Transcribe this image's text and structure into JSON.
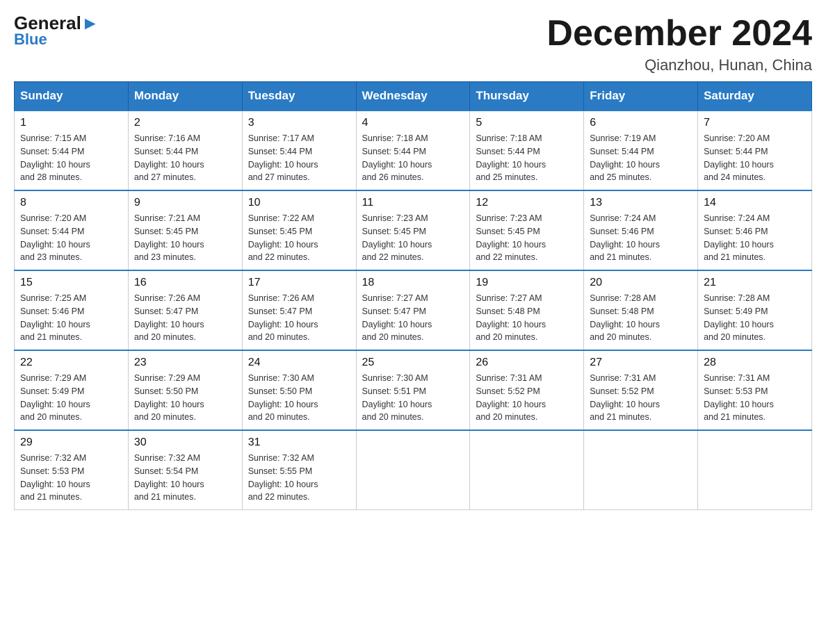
{
  "header": {
    "logo_general": "General",
    "logo_blue": "Blue",
    "title": "December 2024",
    "subtitle": "Qianzhou, Hunan, China"
  },
  "columns": [
    "Sunday",
    "Monday",
    "Tuesday",
    "Wednesday",
    "Thursday",
    "Friday",
    "Saturday"
  ],
  "weeks": [
    [
      {
        "day": "1",
        "sunrise": "7:15 AM",
        "sunset": "5:44 PM",
        "daylight": "10 hours and 28 minutes."
      },
      {
        "day": "2",
        "sunrise": "7:16 AM",
        "sunset": "5:44 PM",
        "daylight": "10 hours and 27 minutes."
      },
      {
        "day": "3",
        "sunrise": "7:17 AM",
        "sunset": "5:44 PM",
        "daylight": "10 hours and 27 minutes."
      },
      {
        "day": "4",
        "sunrise": "7:18 AM",
        "sunset": "5:44 PM",
        "daylight": "10 hours and 26 minutes."
      },
      {
        "day": "5",
        "sunrise": "7:18 AM",
        "sunset": "5:44 PM",
        "daylight": "10 hours and 25 minutes."
      },
      {
        "day": "6",
        "sunrise": "7:19 AM",
        "sunset": "5:44 PM",
        "daylight": "10 hours and 25 minutes."
      },
      {
        "day": "7",
        "sunrise": "7:20 AM",
        "sunset": "5:44 PM",
        "daylight": "10 hours and 24 minutes."
      }
    ],
    [
      {
        "day": "8",
        "sunrise": "7:20 AM",
        "sunset": "5:44 PM",
        "daylight": "10 hours and 23 minutes."
      },
      {
        "day": "9",
        "sunrise": "7:21 AM",
        "sunset": "5:45 PM",
        "daylight": "10 hours and 23 minutes."
      },
      {
        "day": "10",
        "sunrise": "7:22 AM",
        "sunset": "5:45 PM",
        "daylight": "10 hours and 22 minutes."
      },
      {
        "day": "11",
        "sunrise": "7:23 AM",
        "sunset": "5:45 PM",
        "daylight": "10 hours and 22 minutes."
      },
      {
        "day": "12",
        "sunrise": "7:23 AM",
        "sunset": "5:45 PM",
        "daylight": "10 hours and 22 minutes."
      },
      {
        "day": "13",
        "sunrise": "7:24 AM",
        "sunset": "5:46 PM",
        "daylight": "10 hours and 21 minutes."
      },
      {
        "day": "14",
        "sunrise": "7:24 AM",
        "sunset": "5:46 PM",
        "daylight": "10 hours and 21 minutes."
      }
    ],
    [
      {
        "day": "15",
        "sunrise": "7:25 AM",
        "sunset": "5:46 PM",
        "daylight": "10 hours and 21 minutes."
      },
      {
        "day": "16",
        "sunrise": "7:26 AM",
        "sunset": "5:47 PM",
        "daylight": "10 hours and 20 minutes."
      },
      {
        "day": "17",
        "sunrise": "7:26 AM",
        "sunset": "5:47 PM",
        "daylight": "10 hours and 20 minutes."
      },
      {
        "day": "18",
        "sunrise": "7:27 AM",
        "sunset": "5:47 PM",
        "daylight": "10 hours and 20 minutes."
      },
      {
        "day": "19",
        "sunrise": "7:27 AM",
        "sunset": "5:48 PM",
        "daylight": "10 hours and 20 minutes."
      },
      {
        "day": "20",
        "sunrise": "7:28 AM",
        "sunset": "5:48 PM",
        "daylight": "10 hours and 20 minutes."
      },
      {
        "day": "21",
        "sunrise": "7:28 AM",
        "sunset": "5:49 PM",
        "daylight": "10 hours and 20 minutes."
      }
    ],
    [
      {
        "day": "22",
        "sunrise": "7:29 AM",
        "sunset": "5:49 PM",
        "daylight": "10 hours and 20 minutes."
      },
      {
        "day": "23",
        "sunrise": "7:29 AM",
        "sunset": "5:50 PM",
        "daylight": "10 hours and 20 minutes."
      },
      {
        "day": "24",
        "sunrise": "7:30 AM",
        "sunset": "5:50 PM",
        "daylight": "10 hours and 20 minutes."
      },
      {
        "day": "25",
        "sunrise": "7:30 AM",
        "sunset": "5:51 PM",
        "daylight": "10 hours and 20 minutes."
      },
      {
        "day": "26",
        "sunrise": "7:31 AM",
        "sunset": "5:52 PM",
        "daylight": "10 hours and 20 minutes."
      },
      {
        "day": "27",
        "sunrise": "7:31 AM",
        "sunset": "5:52 PM",
        "daylight": "10 hours and 21 minutes."
      },
      {
        "day": "28",
        "sunrise": "7:31 AM",
        "sunset": "5:53 PM",
        "daylight": "10 hours and 21 minutes."
      }
    ],
    [
      {
        "day": "29",
        "sunrise": "7:32 AM",
        "sunset": "5:53 PM",
        "daylight": "10 hours and 21 minutes."
      },
      {
        "day": "30",
        "sunrise": "7:32 AM",
        "sunset": "5:54 PM",
        "daylight": "10 hours and 21 minutes."
      },
      {
        "day": "31",
        "sunrise": "7:32 AM",
        "sunset": "5:55 PM",
        "daylight": "10 hours and 22 minutes."
      },
      null,
      null,
      null,
      null
    ]
  ],
  "labels": {
    "sunrise": "Sunrise: ",
    "sunset": "Sunset: ",
    "daylight": "Daylight: "
  }
}
